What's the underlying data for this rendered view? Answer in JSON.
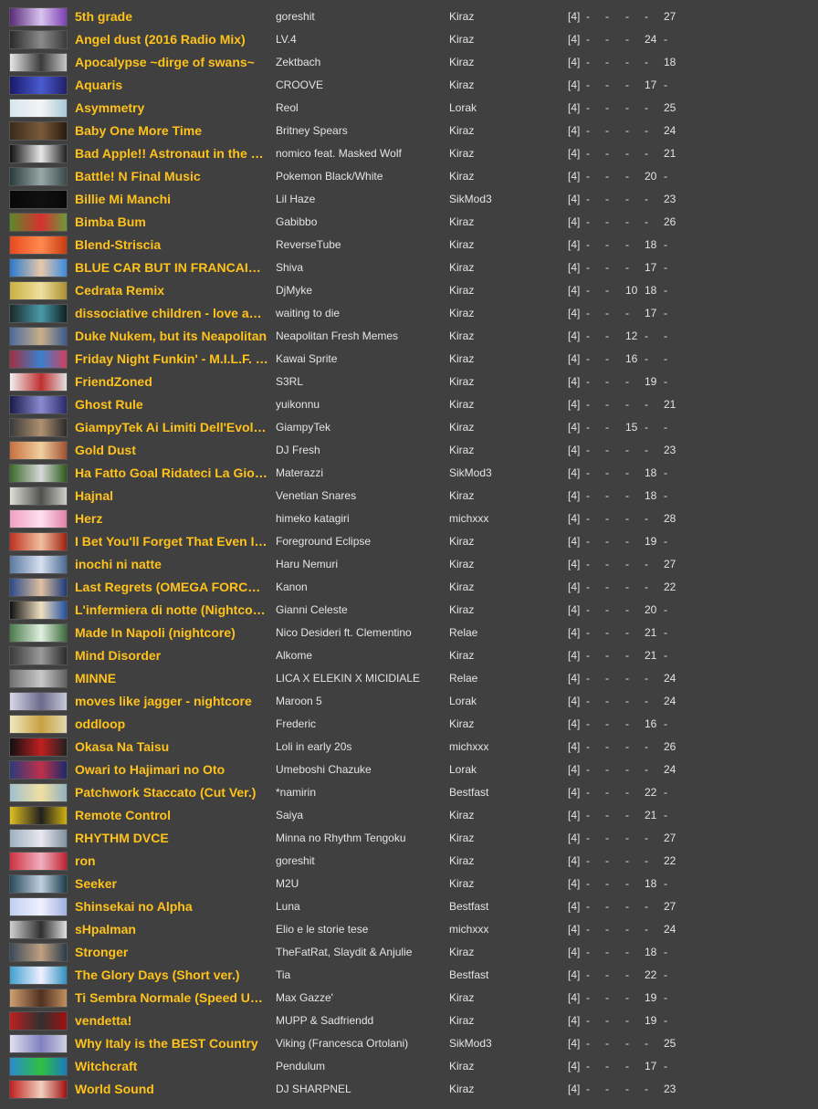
{
  "songs": [
    {
      "title": "5th grade",
      "artist": "goreshit",
      "mapper": "Kiraz",
      "rank": "[4]",
      "cols": [
        "-",
        "-",
        "-",
        "-",
        "27"
      ],
      "thumb": [
        "#5a2a7a",
        "#d9c4f0",
        "#7b3fb0"
      ]
    },
    {
      "title": "Angel dust (2016 Radio Mix)",
      "artist": "LV.4",
      "mapper": "Kiraz",
      "rank": "[4]",
      "cols": [
        "-",
        "-",
        "-",
        "24",
        "-"
      ],
      "thumb": [
        "#2a2a2a",
        "#8a8a8a",
        "#3a3a3a"
      ]
    },
    {
      "title": "Apocalypse ~dirge of swans~",
      "artist": "Zektbach",
      "mapper": "Kiraz",
      "rank": "[4]",
      "cols": [
        "-",
        "-",
        "-",
        "-",
        "18"
      ],
      "thumb": [
        "#e8e8e8",
        "#3a3a3a",
        "#c8c8c8"
      ]
    },
    {
      "title": "Aquaris",
      "artist": "CROOVE",
      "mapper": "Kiraz",
      "rank": "[4]",
      "cols": [
        "-",
        "-",
        "-",
        "17",
        "-"
      ],
      "thumb": [
        "#1a1a6a",
        "#4a5ad0",
        "#20206a"
      ]
    },
    {
      "title": "Asymmetry",
      "artist": "Reol",
      "mapper": "Lorak",
      "rank": "[4]",
      "cols": [
        "-",
        "-",
        "-",
        "-",
        "25"
      ],
      "thumb": [
        "#d8e6ee",
        "#f4f4f4",
        "#a8c8d8"
      ]
    },
    {
      "title": "Baby One More Time",
      "artist": "Britney Spears",
      "mapper": "Kiraz",
      "rank": "[4]",
      "cols": [
        "-",
        "-",
        "-",
        "-",
        "24"
      ],
      "thumb": [
        "#3a2a1a",
        "#7a5a3a",
        "#2a1a10"
      ]
    },
    {
      "title": "Bad Apple!! Astronaut in the Oce...",
      "artist": "nomico feat. Masked Wolf",
      "mapper": "Kiraz",
      "rank": "[4]",
      "cols": [
        "-",
        "-",
        "-",
        "-",
        "21"
      ],
      "thumb": [
        "#101010",
        "#e8e8e8",
        "#202020"
      ]
    },
    {
      "title": "Battle! N Final Music",
      "artist": "Pokemon Black/White",
      "mapper": "Kiraz",
      "rank": "[4]",
      "cols": [
        "-",
        "-",
        "-",
        "20",
        "-"
      ],
      "thumb": [
        "#2a3a3a",
        "#9aa8a8",
        "#3a4a4a"
      ]
    },
    {
      "title": "Billie Mi Manchi",
      "artist": "Lil Haze",
      "mapper": "SikMod3",
      "rank": "[4]",
      "cols": [
        "-",
        "-",
        "-",
        "-",
        "23"
      ],
      "thumb": [
        "#080808",
        "#101010",
        "#080808"
      ]
    },
    {
      "title": "Bimba Bum",
      "artist": "Gabibbo",
      "mapper": "Kiraz",
      "rank": "[4]",
      "cols": [
        "-",
        "-",
        "-",
        "-",
        "26"
      ],
      "thumb": [
        "#5a8a2a",
        "#d83030",
        "#6a9a3a"
      ]
    },
    {
      "title": "Blend-Striscia",
      "artist": "ReverseTube",
      "mapper": "Kiraz",
      "rank": "[4]",
      "cols": [
        "-",
        "-",
        "-",
        "18",
        "-"
      ],
      "thumb": [
        "#e84a20",
        "#ff8a50",
        "#c83a10"
      ]
    },
    {
      "title": "BLUE CAR BUT IN FRANCAIS ...",
      "artist": "Shiva",
      "mapper": "Kiraz",
      "rank": "[4]",
      "cols": [
        "-",
        "-",
        "-",
        "17",
        "-"
      ],
      "thumb": [
        "#2a7ad0",
        "#e8c8a8",
        "#3a8ae0"
      ]
    },
    {
      "title": "Cedrata Remix",
      "artist": "DjMyke",
      "mapper": "Kiraz",
      "rank": "[4]",
      "cols": [
        "-",
        "-",
        "10",
        "18",
        "-"
      ],
      "thumb": [
        "#c8b040",
        "#f0e0a0",
        "#a89030"
      ]
    },
    {
      "title": "dissociative children - love addict ...",
      "artist": "waiting to die",
      "mapper": "Kiraz",
      "rank": "[4]",
      "cols": [
        "-",
        "-",
        "-",
        "17",
        "-"
      ],
      "thumb": [
        "#1a2a2a",
        "#4a9aaa",
        "#102020"
      ]
    },
    {
      "title": "Duke Nukem, but its Neapolitan",
      "artist": "Neapolitan Fresh Memes",
      "mapper": "Kiraz",
      "rank": "[4]",
      "cols": [
        "-",
        "-",
        "12",
        "-",
        "-"
      ],
      "thumb": [
        "#4a6aa0",
        "#c8b088",
        "#3a5a90"
      ]
    },
    {
      "title": "Friday Night Funkin' - M.I.L.F. (B...",
      "artist": "Kawai Sprite",
      "mapper": "Kiraz",
      "rank": "[4]",
      "cols": [
        "-",
        "-",
        "16",
        "-",
        "-"
      ],
      "thumb": [
        "#a03040",
        "#3a80d0",
        "#d04060"
      ]
    },
    {
      "title": "FriendZoned",
      "artist": "S3RL",
      "mapper": "Kiraz",
      "rank": "[4]",
      "cols": [
        "-",
        "-",
        "-",
        "19",
        "-"
      ],
      "thumb": [
        "#f0f0f0",
        "#c03030",
        "#e0e0e0"
      ]
    },
    {
      "title": "Ghost Rule",
      "artist": "yuikonnu",
      "mapper": "Kiraz",
      "rank": "[4]",
      "cols": [
        "-",
        "-",
        "-",
        "-",
        "21"
      ],
      "thumb": [
        "#1a1a4a",
        "#8a8ad0",
        "#2a2a6a"
      ]
    },
    {
      "title": "GiampyTek Ai Limiti Dell'Evoluto",
      "artist": "GiampyTek",
      "mapper": "Kiraz",
      "rank": "[4]",
      "cols": [
        "-",
        "-",
        "15",
        "-",
        "-"
      ],
      "thumb": [
        "#3a3a3a",
        "#b09070",
        "#2a2a2a"
      ]
    },
    {
      "title": "Gold Dust",
      "artist": "DJ Fresh",
      "mapper": "Kiraz",
      "rank": "[4]",
      "cols": [
        "-",
        "-",
        "-",
        "-",
        "23"
      ],
      "thumb": [
        "#c87040",
        "#f0d0a0",
        "#a05030"
      ]
    },
    {
      "title": "Ha Fatto Goal Ridateci La Gioc...",
      "artist": "Materazzi",
      "mapper": "SikMod3",
      "rank": "[4]",
      "cols": [
        "-",
        "-",
        "-",
        "18",
        "-"
      ],
      "thumb": [
        "#3a6a2a",
        "#d8d8d8",
        "#2a5a1a"
      ]
    },
    {
      "title": "Hajnal",
      "artist": "Venetian Snares",
      "mapper": "Kiraz",
      "rank": "[4]",
      "cols": [
        "-",
        "-",
        "-",
        "18",
        "-"
      ],
      "thumb": [
        "#e0e0d8",
        "#505050",
        "#d0d0c8"
      ]
    },
    {
      "title": "Herz",
      "artist": "himeko katagiri",
      "mapper": "michxxx",
      "rank": "[4]",
      "cols": [
        "-",
        "-",
        "-",
        "-",
        "28"
      ],
      "thumb": [
        "#f0a0c0",
        "#ffe0f0",
        "#e080a8"
      ]
    },
    {
      "title": "I Bet You'll Forget That Even If ...",
      "artist": "Foreground Eclipse",
      "mapper": "Kiraz",
      "rank": "[4]",
      "cols": [
        "-",
        "-",
        "-",
        "19",
        "-"
      ],
      "thumb": [
        "#c03020",
        "#f0c0a0",
        "#a02010"
      ]
    },
    {
      "title": "inochi ni natte",
      "artist": "Haru Nemuri",
      "mapper": "Kiraz",
      "rank": "[4]",
      "cols": [
        "-",
        "-",
        "-",
        "-",
        "27"
      ],
      "thumb": [
        "#5a7aa0",
        "#d8e0f0",
        "#4a6a90"
      ]
    },
    {
      "title": "Last Regrets (OMEGA FORCE ...",
      "artist": "Kanon",
      "mapper": "Kiraz",
      "rank": "[4]",
      "cols": [
        "-",
        "-",
        "-",
        "-",
        "22"
      ],
      "thumb": [
        "#2a4a8a",
        "#e0c0a0",
        "#1a3a7a"
      ]
    },
    {
      "title": "L'infermiera di notte (Nightcore)",
      "artist": "Gianni Celeste",
      "mapper": "Kiraz",
      "rank": "[4]",
      "cols": [
        "-",
        "-",
        "-",
        "20",
        "-"
      ],
      "thumb": [
        "#101010",
        "#f0e0c0",
        "#2050a0"
      ]
    },
    {
      "title": "Made In Napoli (nightcore)",
      "artist": "Nico Desideri ft. Clementino",
      "mapper": "Relae",
      "rank": "[4]",
      "cols": [
        "-",
        "-",
        "-",
        "21",
        "-"
      ],
      "thumb": [
        "#4a7a4a",
        "#e0f0e0",
        "#3a6a3a"
      ]
    },
    {
      "title": "Mind Disorder",
      "artist": "Alkome",
      "mapper": "Kiraz",
      "rank": "[4]",
      "cols": [
        "-",
        "-",
        "-",
        "21",
        "-"
      ],
      "thumb": [
        "#3a3a3a",
        "#9a9a9a",
        "#2a2a2a"
      ]
    },
    {
      "title": "MINNE",
      "artist": "LICA X ELEKIN X MICIDIALE",
      "mapper": "Relae",
      "rank": "[4]",
      "cols": [
        "-",
        "-",
        "-",
        "-",
        "24"
      ],
      "thumb": [
        "#707070",
        "#c8c8c8",
        "#606060"
      ]
    },
    {
      "title": "moves like jagger - nightcore",
      "artist": "Maroon 5",
      "mapper": "Lorak",
      "rank": "[4]",
      "cols": [
        "-",
        "-",
        "-",
        "-",
        "24"
      ],
      "thumb": [
        "#d8d8e8",
        "#6a6a8a",
        "#c8c8d8"
      ]
    },
    {
      "title": "oddloop",
      "artist": "Frederic",
      "mapper": "Kiraz",
      "rank": "[4]",
      "cols": [
        "-",
        "-",
        "-",
        "16",
        "-"
      ],
      "thumb": [
        "#f0e8c0",
        "#c8a040",
        "#e0d8b0"
      ]
    },
    {
      "title": "Okasa Na Taisu",
      "artist": "Loli in early 20s",
      "mapper": "michxxx",
      "rank": "[4]",
      "cols": [
        "-",
        "-",
        "-",
        "-",
        "26"
      ],
      "thumb": [
        "#101010",
        "#c02020",
        "#202020"
      ]
    },
    {
      "title": "Owari to Hajimari no Oto",
      "artist": "Umeboshi Chazuke",
      "mapper": "Lorak",
      "rank": "[4]",
      "cols": [
        "-",
        "-",
        "-",
        "-",
        "24"
      ],
      "thumb": [
        "#2a3a7a",
        "#c0304a",
        "#1a2a6a"
      ]
    },
    {
      "title": "Patchwork Staccato (Cut Ver.)",
      "artist": "*namirin",
      "mapper": "Bestfast",
      "rank": "[4]",
      "cols": [
        "-",
        "-",
        "-",
        "22",
        "-"
      ],
      "thumb": [
        "#a0c0d0",
        "#f0e0a0",
        "#90b0c0"
      ]
    },
    {
      "title": "Remote Control",
      "artist": "Saiya",
      "mapper": "Kiraz",
      "rank": "[4]",
      "cols": [
        "-",
        "-",
        "-",
        "21",
        "-"
      ],
      "thumb": [
        "#e0c020",
        "#202020",
        "#d0b010"
      ]
    },
    {
      "title": "RHYTHM DVCE",
      "artist": "Minna no Rhythm Tengoku",
      "mapper": "Kiraz",
      "rank": "[4]",
      "cols": [
        "-",
        "-",
        "-",
        "-",
        "27"
      ],
      "thumb": [
        "#a0b0c0",
        "#e8e8f0",
        "#8090a0"
      ]
    },
    {
      "title": "ron",
      "artist": "goreshit",
      "mapper": "Kiraz",
      "rank": "[4]",
      "cols": [
        "-",
        "-",
        "-",
        "-",
        "22"
      ],
      "thumb": [
        "#d03040",
        "#f0b0c0",
        "#c02030"
      ]
    },
    {
      "title": "Seeker",
      "artist": "M2U",
      "mapper": "Kiraz",
      "rank": "[4]",
      "cols": [
        "-",
        "-",
        "-",
        "18",
        "-"
      ],
      "thumb": [
        "#2a4a5a",
        "#c0d0e0",
        "#1a3a4a"
      ]
    },
    {
      "title": "Shinsekai no Alpha",
      "artist": "Luna",
      "mapper": "Bestfast",
      "rank": "[4]",
      "cols": [
        "-",
        "-",
        "-",
        "-",
        "27"
      ],
      "thumb": [
        "#c0d0f0",
        "#f0f0ff",
        "#a0b0e0"
      ]
    },
    {
      "title": "sHpalman",
      "artist": "Elio e le storie tese",
      "mapper": "michxxx",
      "rank": "[4]",
      "cols": [
        "-",
        "-",
        "-",
        "-",
        "24"
      ],
      "thumb": [
        "#d0d0d0",
        "#303030",
        "#e0e0e0"
      ]
    },
    {
      "title": "Stronger",
      "artist": "TheFatRat, Slaydit & Anjulie",
      "mapper": "Kiraz",
      "rank": "[4]",
      "cols": [
        "-",
        "-",
        "-",
        "18",
        "-"
      ],
      "thumb": [
        "#3a4a5a",
        "#c0a080",
        "#2a3a4a"
      ]
    },
    {
      "title": "The Glory Days (Short ver.)",
      "artist": "Tia",
      "mapper": "Bestfast",
      "rank": "[4]",
      "cols": [
        "-",
        "-",
        "-",
        "22",
        "-"
      ],
      "thumb": [
        "#40a0d0",
        "#f0f0ff",
        "#3090c0"
      ]
    },
    {
      "title": "Ti Sembra Normale (Speed Up...",
      "artist": "Max Gazze'",
      "mapper": "Kiraz",
      "rank": "[4]",
      "cols": [
        "-",
        "-",
        "-",
        "19",
        "-"
      ],
      "thumb": [
        "#d0a070",
        "#503020",
        "#c09060"
      ]
    },
    {
      "title": "vendetta!",
      "artist": "MUPP & Sadfriendd",
      "mapper": "Kiraz",
      "rank": "[4]",
      "cols": [
        "-",
        "-",
        "-",
        "19",
        "-"
      ],
      "thumb": [
        "#c02020",
        "#303030",
        "#a01010"
      ]
    },
    {
      "title": "Why Italy is the BEST Country",
      "artist": "Viking (Francesca Ortolani)",
      "mapper": "SikMod3",
      "rank": "[4]",
      "cols": [
        "-",
        "-",
        "-",
        "-",
        "25"
      ],
      "thumb": [
        "#e0e0f0",
        "#8080c0",
        "#d0d0e0"
      ]
    },
    {
      "title": "Witchcraft",
      "artist": "Pendulum",
      "mapper": "Kiraz",
      "rank": "[4]",
      "cols": [
        "-",
        "-",
        "-",
        "17",
        "-"
      ],
      "thumb": [
        "#2a8ad0",
        "#30c040",
        "#1a7ac0"
      ]
    },
    {
      "title": "World Sound",
      "artist": "DJ SHARPNEL",
      "mapper": "Kiraz",
      "rank": "[4]",
      "cols": [
        "-",
        "-",
        "-",
        "-",
        "23"
      ],
      "thumb": [
        "#c02020",
        "#f0d0c0",
        "#a01010"
      ]
    }
  ]
}
